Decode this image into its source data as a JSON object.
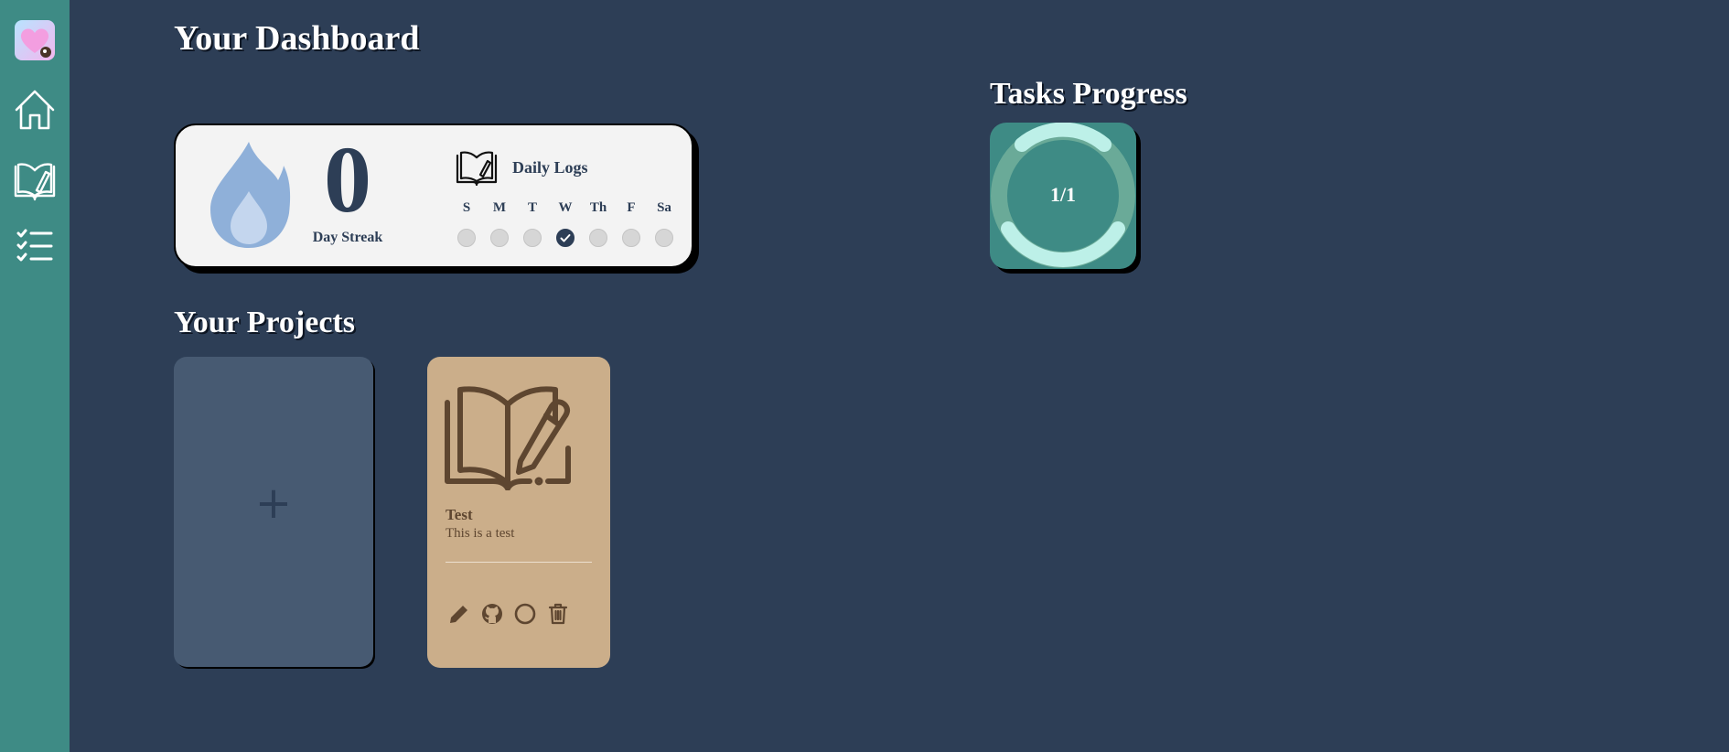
{
  "sidebar": {
    "items": [
      {
        "name": "home",
        "icon": "home-icon"
      },
      {
        "name": "logs",
        "icon": "book-pen-icon"
      },
      {
        "name": "tasks",
        "icon": "checklist-icon"
      }
    ],
    "logo_icon": "heart-cat-logo"
  },
  "dashboard": {
    "title": "Your Dashboard"
  },
  "streak": {
    "count": "0",
    "label": "Day Streak",
    "logs_title": "Daily Logs",
    "days": [
      {
        "label": "S",
        "done": false
      },
      {
        "label": "M",
        "done": false
      },
      {
        "label": "T",
        "done": false
      },
      {
        "label": "W",
        "done": true
      },
      {
        "label": "Th",
        "done": false
      },
      {
        "label": "F",
        "done": false
      },
      {
        "label": "Sa",
        "done": false
      }
    ]
  },
  "tasks": {
    "title": "Tasks Progress",
    "progress_text": "1/1",
    "completed": 1,
    "total": 1
  },
  "projects": {
    "title": "Your Projects",
    "add_label": "+",
    "items": [
      {
        "title": "Test",
        "description": "This is a test"
      }
    ]
  },
  "colors": {
    "background": "#2d3e56",
    "sidebar": "#3e8b85",
    "card_light": "#f3f3f3",
    "project_card": "#cbae8a",
    "add_card": "#475a72",
    "flame": "#8fb0d9",
    "ring": "#bdf0e8"
  }
}
